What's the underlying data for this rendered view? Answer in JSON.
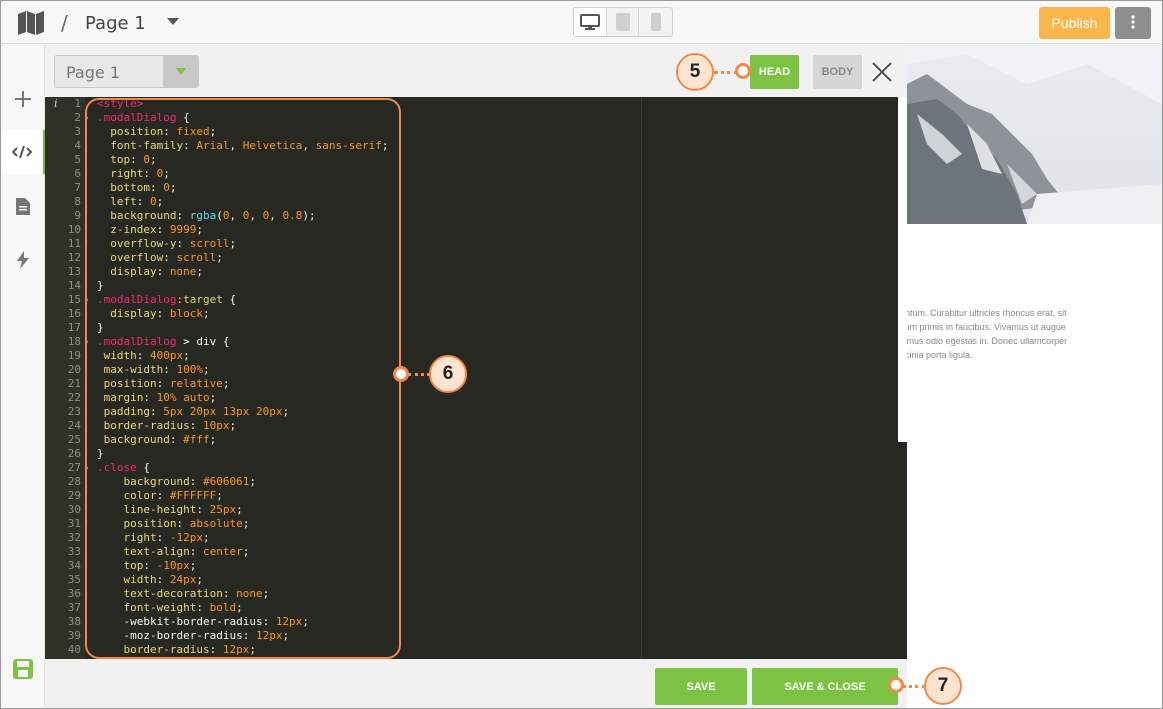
{
  "topbar": {
    "page_label": "Page 1",
    "slash": "/",
    "publish_label": "Publish"
  },
  "editor": {
    "page_select_value": "Page 1",
    "head_label": "HEAD",
    "body_label": "BODY",
    "save_label": "SAVE",
    "save_close_label": "SAVE & CLOSE",
    "info_marker": "i",
    "code_lines": [
      [
        [
          "tag",
          "<style>"
        ]
      ],
      [
        [
          "sel",
          ".modalDialog"
        ],
        [
          "pun",
          " {"
        ]
      ],
      [
        [
          "pun",
          "  "
        ],
        [
          "prop",
          "position"
        ],
        [
          "pun",
          ": "
        ],
        [
          "val",
          "fixed"
        ],
        [
          "pun",
          ";"
        ]
      ],
      [
        [
          "pun",
          "  "
        ],
        [
          "prop",
          "font-family"
        ],
        [
          "pun",
          ": "
        ],
        [
          "val",
          "Arial"
        ],
        [
          "pun",
          ", "
        ],
        [
          "val",
          "Helvetica"
        ],
        [
          "pun",
          ", "
        ],
        [
          "val",
          "sans-serif"
        ],
        [
          "pun",
          ";"
        ]
      ],
      [
        [
          "pun",
          "  "
        ],
        [
          "prop",
          "top"
        ],
        [
          "pun",
          ": "
        ],
        [
          "val",
          "0"
        ],
        [
          "pun",
          ";"
        ]
      ],
      [
        [
          "pun",
          "  "
        ],
        [
          "prop",
          "right"
        ],
        [
          "pun",
          ": "
        ],
        [
          "val",
          "0"
        ],
        [
          "pun",
          ";"
        ]
      ],
      [
        [
          "pun",
          "  "
        ],
        [
          "prop",
          "bottom"
        ],
        [
          "pun",
          ": "
        ],
        [
          "val",
          "0"
        ],
        [
          "pun",
          ";"
        ]
      ],
      [
        [
          "pun",
          "  "
        ],
        [
          "prop",
          "left"
        ],
        [
          "pun",
          ": "
        ],
        [
          "val",
          "0"
        ],
        [
          "pun",
          ";"
        ]
      ],
      [
        [
          "pun",
          "  "
        ],
        [
          "prop",
          "background"
        ],
        [
          "pun",
          ": "
        ],
        [
          "fn",
          "rgba"
        ],
        [
          "pun",
          "("
        ],
        [
          "val",
          "0"
        ],
        [
          "pun",
          ", "
        ],
        [
          "val",
          "0"
        ],
        [
          "pun",
          ", "
        ],
        [
          "val",
          "0"
        ],
        [
          "pun",
          ", "
        ],
        [
          "val",
          "0.8"
        ],
        [
          "pun",
          ");"
        ]
      ],
      [
        [
          "pun",
          "  "
        ],
        [
          "prop",
          "z-index"
        ],
        [
          "pun",
          ": "
        ],
        [
          "val",
          "9999"
        ],
        [
          "pun",
          ";"
        ]
      ],
      [
        [
          "pun",
          "  "
        ],
        [
          "prop",
          "overflow-y"
        ],
        [
          "pun",
          ": "
        ],
        [
          "val",
          "scroll"
        ],
        [
          "pun",
          ";"
        ]
      ],
      [
        [
          "pun",
          "  "
        ],
        [
          "prop",
          "overflow"
        ],
        [
          "pun",
          ": "
        ],
        [
          "val",
          "scroll"
        ],
        [
          "pun",
          ";"
        ]
      ],
      [
        [
          "pun",
          "  "
        ],
        [
          "prop",
          "display"
        ],
        [
          "pun",
          ": "
        ],
        [
          "val",
          "none"
        ],
        [
          "pun",
          ";"
        ]
      ],
      [
        [
          "pun",
          "}"
        ]
      ],
      [
        [
          "sel",
          ".modalDialog"
        ],
        [
          "prop",
          ":target"
        ],
        [
          "pun",
          " {"
        ]
      ],
      [
        [
          "pun",
          "  "
        ],
        [
          "prop",
          "display"
        ],
        [
          "pun",
          ": "
        ],
        [
          "val",
          "block"
        ],
        [
          "pun",
          ";"
        ]
      ],
      [
        [
          "pun",
          "}"
        ]
      ],
      [
        [
          "sel",
          ".modalDialog"
        ],
        [
          "pun",
          " > div {"
        ]
      ],
      [
        [
          "pun",
          " "
        ],
        [
          "prop",
          "width"
        ],
        [
          "pun",
          ": "
        ],
        [
          "val",
          "400px"
        ],
        [
          "pun",
          ";"
        ]
      ],
      [
        [
          "pun",
          " "
        ],
        [
          "prop",
          "max-width"
        ],
        [
          "pun",
          ": "
        ],
        [
          "val",
          "100%"
        ],
        [
          "pun",
          ";"
        ]
      ],
      [
        [
          "pun",
          " "
        ],
        [
          "prop",
          "position"
        ],
        [
          "pun",
          ": "
        ],
        [
          "val",
          "relative"
        ],
        [
          "pun",
          ";"
        ]
      ],
      [
        [
          "pun",
          " "
        ],
        [
          "prop",
          "margin"
        ],
        [
          "pun",
          ": "
        ],
        [
          "val",
          "10% auto"
        ],
        [
          "pun",
          ";"
        ]
      ],
      [
        [
          "pun",
          " "
        ],
        [
          "prop",
          "padding"
        ],
        [
          "pun",
          ": "
        ],
        [
          "val",
          "5px 20px 13px 20px"
        ],
        [
          "pun",
          ";"
        ]
      ],
      [
        [
          "pun",
          " "
        ],
        [
          "prop",
          "border-radius"
        ],
        [
          "pun",
          ": "
        ],
        [
          "val",
          "10px"
        ],
        [
          "pun",
          ";"
        ]
      ],
      [
        [
          "pun",
          " "
        ],
        [
          "prop",
          "background"
        ],
        [
          "pun",
          ": "
        ],
        [
          "val",
          "#fff"
        ],
        [
          "pun",
          ";"
        ]
      ],
      [
        [
          "pun",
          "}"
        ]
      ],
      [
        [
          "sel",
          ".close"
        ],
        [
          "pun",
          " {"
        ]
      ],
      [
        [
          "pun",
          "    "
        ],
        [
          "prop",
          "background"
        ],
        [
          "pun",
          ": "
        ],
        [
          "val",
          "#606061"
        ],
        [
          "pun",
          ";"
        ]
      ],
      [
        [
          "pun",
          "    "
        ],
        [
          "prop",
          "color"
        ],
        [
          "pun",
          ": "
        ],
        [
          "val",
          "#FFFFFF"
        ],
        [
          "pun",
          ";"
        ]
      ],
      [
        [
          "pun",
          "    "
        ],
        [
          "prop",
          "line-height"
        ],
        [
          "pun",
          ": "
        ],
        [
          "val",
          "25px"
        ],
        [
          "pun",
          ";"
        ]
      ],
      [
        [
          "pun",
          "    "
        ],
        [
          "prop",
          "position"
        ],
        [
          "pun",
          ": "
        ],
        [
          "val",
          "absolute"
        ],
        [
          "pun",
          ";"
        ]
      ],
      [
        [
          "pun",
          "    "
        ],
        [
          "prop",
          "right"
        ],
        [
          "pun",
          ": "
        ],
        [
          "val",
          "-12px"
        ],
        [
          "pun",
          ";"
        ]
      ],
      [
        [
          "pun",
          "    "
        ],
        [
          "prop",
          "text-align"
        ],
        [
          "pun",
          ": "
        ],
        [
          "val",
          "center"
        ],
        [
          "pun",
          ";"
        ]
      ],
      [
        [
          "pun",
          "    "
        ],
        [
          "prop",
          "top"
        ],
        [
          "pun",
          ": "
        ],
        [
          "val",
          "-10px"
        ],
        [
          "pun",
          ";"
        ]
      ],
      [
        [
          "pun",
          "    "
        ],
        [
          "prop",
          "width"
        ],
        [
          "pun",
          ": "
        ],
        [
          "val",
          "24px"
        ],
        [
          "pun",
          ";"
        ]
      ],
      [
        [
          "pun",
          "    "
        ],
        [
          "prop",
          "text-decoration"
        ],
        [
          "pun",
          ": "
        ],
        [
          "val",
          "none"
        ],
        [
          "pun",
          ";"
        ]
      ],
      [
        [
          "pun",
          "    "
        ],
        [
          "prop",
          "font-weight"
        ],
        [
          "pun",
          ": "
        ],
        [
          "val",
          "bold"
        ],
        [
          "pun",
          ";"
        ]
      ],
      [
        [
          "pun",
          "    -webkit-border-radius: "
        ],
        [
          "val",
          "12px"
        ],
        [
          "pun",
          ";"
        ]
      ],
      [
        [
          "pun",
          "    -moz-border-radius: "
        ],
        [
          "val",
          "12px"
        ],
        [
          "pun",
          ";"
        ]
      ],
      [
        [
          "pun",
          "    "
        ],
        [
          "prop",
          "border-radius"
        ],
        [
          "pun",
          ": "
        ],
        [
          "val",
          "12px"
        ],
        [
          "pun",
          ";"
        ]
      ]
    ],
    "fold_lines": [
      2,
      15,
      18,
      27
    ]
  },
  "preview": {
    "text_lines": [
      "entum. Curabitur ultricies rhoncus erat, sit",
      "sum primis in faucibus. Vivamus ut augue",
      "ximus odio egestas in. Donec ullamcorper",
      "acinia porta ligula."
    ]
  },
  "callouts": {
    "c5": "5",
    "c6": "6",
    "c7": "7"
  },
  "colors": {
    "accent_green": "#7dc242",
    "publish_orange": "#f8b64c",
    "callout_orange": "#f08a4b",
    "editor_bg": "#272822"
  },
  "icons": {
    "map": "map-icon",
    "desktop": "desktop-icon",
    "tablet": "tablet-icon",
    "phone": "phone-icon",
    "kebab": "kebab-icon",
    "plus": "plus-icon",
    "code": "code-icon",
    "document": "document-icon",
    "bolt": "bolt-icon",
    "save": "save-icon",
    "close": "close-icon"
  }
}
